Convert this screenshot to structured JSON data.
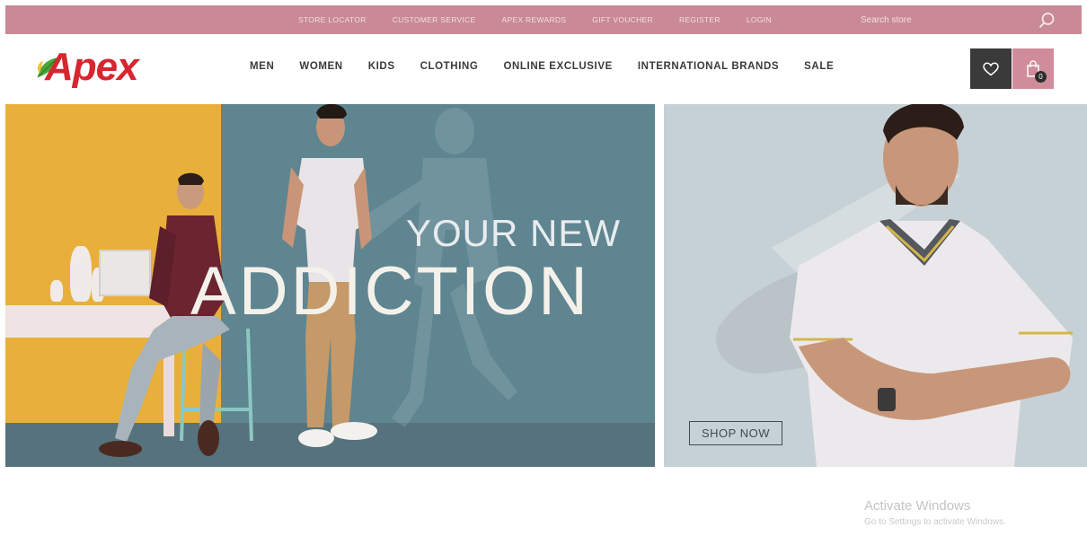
{
  "top_bar": {
    "links": [
      "STORE LOCATOR",
      "CUSTOMER SERVICE",
      "APEX REWARDS",
      "GIFT VOUCHER",
      "REGISTER",
      "LOGIN"
    ],
    "search_placeholder": "Search store"
  },
  "header": {
    "logo_text": "Apex",
    "nav": [
      "MEN",
      "WOMEN",
      "KIDS",
      "CLOTHING",
      "ONLINE EXCLUSIVE",
      "INTERNATIONAL BRANDS",
      "SALE"
    ],
    "cart_count": "0"
  },
  "hero": {
    "headline_small": "YOUR NEW",
    "headline_big": "ADDICTION"
  },
  "side_banner": {
    "cta": "SHOP NOW"
  },
  "watermark": {
    "title": "Activate Windows",
    "subtitle": "Go to Settings to activate Windows."
  },
  "colors": {
    "top_bar": "#c98a95",
    "cart_button": "#d18c9a",
    "wishlist_button": "#3a3a3a",
    "brand_red": "#d7262f"
  }
}
